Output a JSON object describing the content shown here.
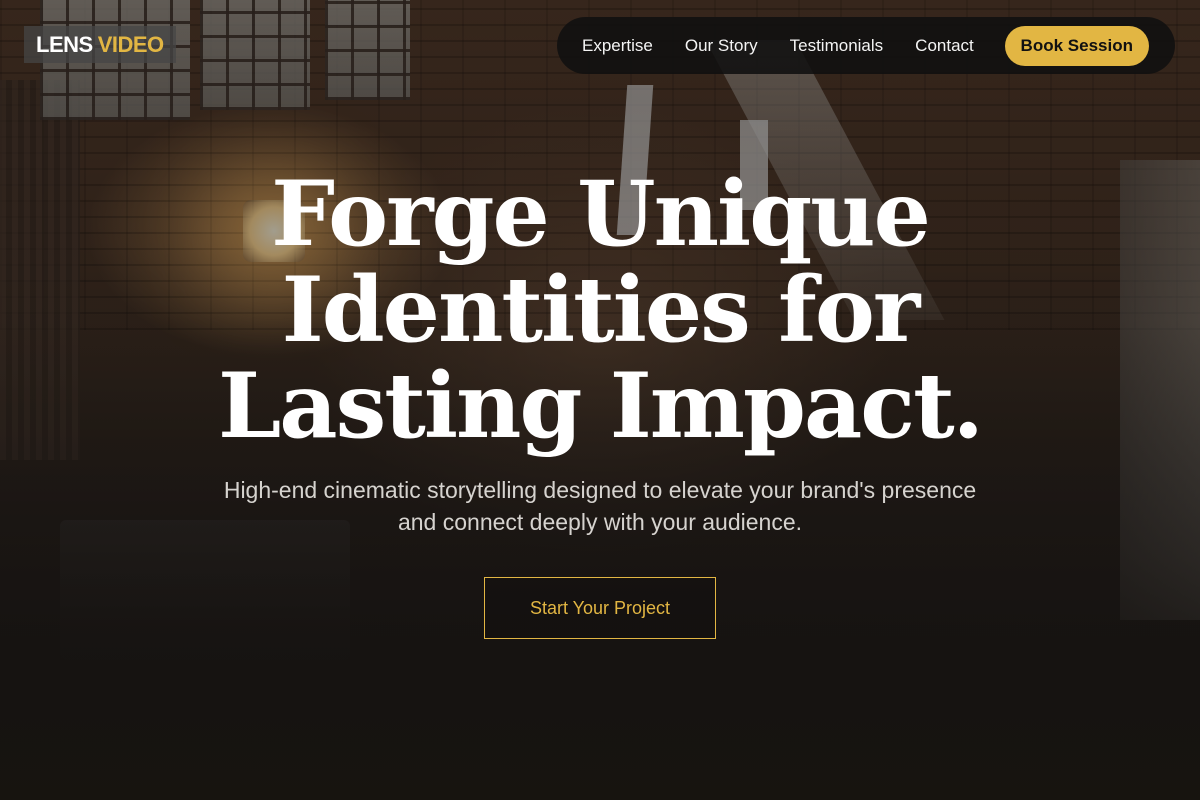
{
  "logo": {
    "part1": "LENS",
    "part2": "VIDEO"
  },
  "nav": {
    "items": [
      {
        "label": "Expertise"
      },
      {
        "label": "Our Story"
      },
      {
        "label": "Testimonials"
      },
      {
        "label": "Contact"
      }
    ],
    "cta_label": "Book Session"
  },
  "hero": {
    "title_lines": [
      "Forge Unique",
      "Identities for",
      "Lasting Impact."
    ],
    "subtitle_lines": [
      "High-end cinematic storytelling designed to elevate your brand's presence",
      "and connect deeply with your audience."
    ],
    "cta_label": "Start Your Project"
  },
  "colors": {
    "accent": "#e2b643",
    "nav_background": "#101010",
    "text": "#ffffff"
  }
}
